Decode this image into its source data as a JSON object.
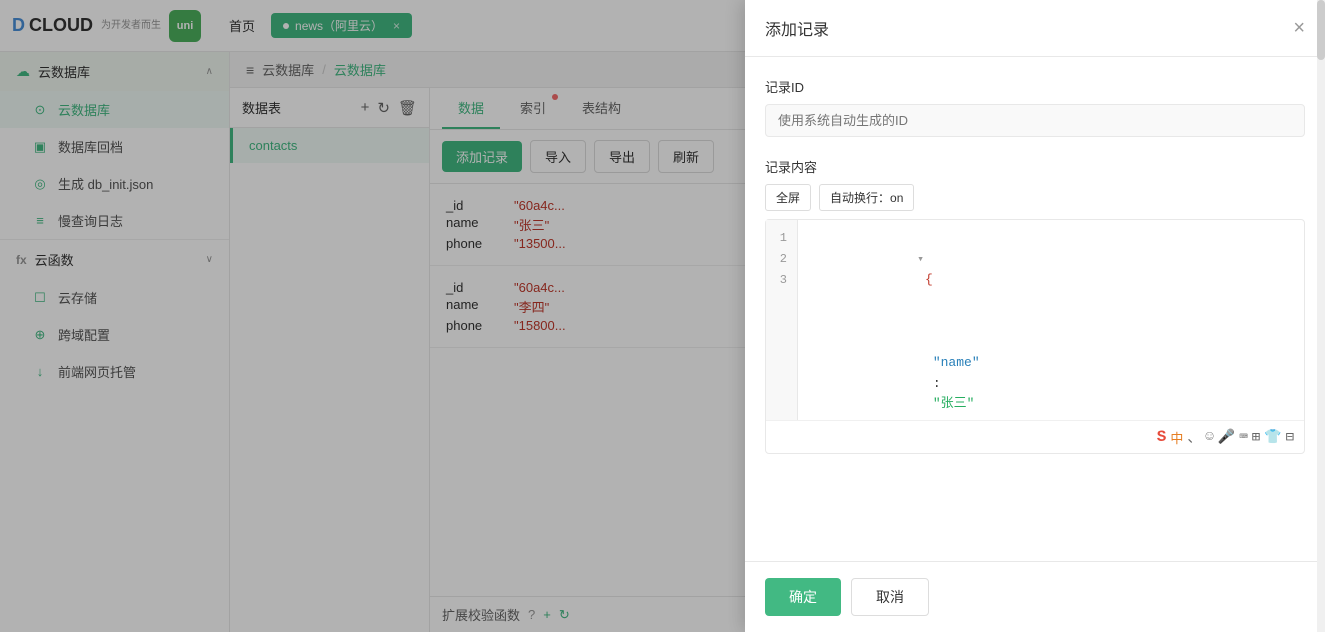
{
  "app": {
    "logo_d": "D",
    "logo_cloud": "CLOUD",
    "logo_sub": "为开发者而生",
    "uni_badge": "uni"
  },
  "topbar": {
    "home_tab": "首页",
    "project_tab": "news（阿里云）",
    "project_dot": true
  },
  "breadcrumb": {
    "icon": "≡",
    "parent": "云数据库",
    "separator": "/",
    "current": "云数据库"
  },
  "sidebar": {
    "db_group": "云数据库",
    "items": [
      {
        "label": "云数据库",
        "icon": "db",
        "active": true
      },
      {
        "label": "数据库回档",
        "icon": "rect"
      },
      {
        "label": "生成 db_init.json",
        "icon": "circle"
      },
      {
        "label": "慢查询日志",
        "icon": "doc"
      }
    ],
    "cloud_functions": "云函数",
    "cloud_storage": "云存储",
    "cross_domain": "跨域配置",
    "frontend_hosting": "前端网页托管"
  },
  "tables_panel": {
    "title": "数据表",
    "add_icon": "+",
    "refresh_icon": "↻",
    "delete_icon": "🗑",
    "tables": [
      {
        "name": "contacts",
        "active": true
      }
    ]
  },
  "data_tabs": [
    {
      "label": "数据",
      "active": true,
      "badge": false
    },
    {
      "label": "索引",
      "active": false,
      "badge": true
    },
    {
      "label": "表结构",
      "active": false,
      "badge": false
    }
  ],
  "data_toolbar": {
    "add_btn": "添加记录",
    "import_btn": "导入",
    "export_btn": "导出",
    "refresh_btn": "刷新"
  },
  "records": [
    {
      "fields": [
        {
          "key": "_id",
          "value": "\"60a4c..."
        },
        {
          "key": "name",
          "value": "\"张三\""
        },
        {
          "key": "phone",
          "value": "\"13500..."
        }
      ]
    },
    {
      "fields": [
        {
          "key": "_id",
          "value": "\"60a4c..."
        },
        {
          "key": "name",
          "value": "\"李四\""
        },
        {
          "key": "phone",
          "value": "\"15800..."
        }
      ]
    }
  ],
  "extend_bar": {
    "label": "扩展校验函数",
    "help": "?",
    "add": "+",
    "refresh": "↻"
  },
  "modal": {
    "title": "添加记录",
    "close_icon": "×",
    "record_id_label": "记录ID",
    "record_id_placeholder": "使用系统自动生成的ID",
    "record_content_label": "记录内容",
    "fullscreen_btn": "全屏",
    "auto_wrap_btn": "自动换行：on",
    "code_lines": [
      {
        "num": 1,
        "content": "▾ {",
        "type": "brace"
      },
      {
        "num": 2,
        "content": "    \"name\": \"张三\"",
        "type": "keyval"
      },
      {
        "num": 3,
        "content": "}",
        "type": "brace"
      }
    ],
    "confirm_btn": "确定",
    "cancel_btn": "取消"
  }
}
